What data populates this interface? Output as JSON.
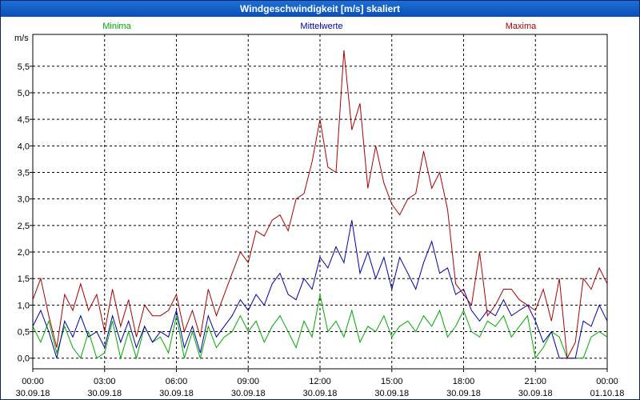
{
  "window": {
    "title": "Windgeschwindigkeit [m/s] skaliert"
  },
  "chart_data": {
    "type": "line",
    "title": "Windgeschwindigkeit [m/s] skaliert",
    "ylabel": "m/s",
    "ylim": [
      -0.2,
      6.1
    ],
    "yticks": [
      0,
      0.5,
      1,
      1.5,
      2,
      2.5,
      3,
      3.5,
      4,
      4.5,
      5,
      5.5
    ],
    "ytick_labels": [
      "0,0",
      "0,5",
      "1,0",
      "1,5",
      "2,0",
      "2,5",
      "3,0",
      "3,5",
      "4,0",
      "4,5",
      "5,0",
      "5,5"
    ],
    "xlim_hours": [
      0,
      24
    ],
    "xticks": [
      {
        "time": "00:00",
        "date": "30.09.18",
        "hour": 0
      },
      {
        "time": "03:00",
        "date": "30.09.18",
        "hour": 3
      },
      {
        "time": "06:00",
        "date": "30.09.18",
        "hour": 6
      },
      {
        "time": "09:00",
        "date": "30.09.18",
        "hour": 9
      },
      {
        "time": "12:00",
        "date": "30.09.18",
        "hour": 12
      },
      {
        "time": "15:00",
        "date": "30.09.18",
        "hour": 15
      },
      {
        "time": "18:00",
        "date": "30.09.18",
        "hour": 18
      },
      {
        "time": "21:00",
        "date": "30.09.18",
        "hour": 21
      },
      {
        "time": "00:00",
        "date": "01.10.18",
        "hour": 24
      }
    ],
    "grid": true,
    "legend_position": "top",
    "series": [
      {
        "name": "Minima",
        "color": "#00aa00",
        "x": [
          0,
          0.33,
          0.67,
          1,
          1.33,
          1.67,
          2,
          2.33,
          2.67,
          3,
          3.33,
          3.67,
          4,
          4.33,
          4.67,
          5,
          5.33,
          5.67,
          6,
          6.33,
          6.67,
          7,
          7.33,
          7.67,
          8,
          8.33,
          8.67,
          9,
          9.33,
          9.67,
          10,
          10.33,
          10.67,
          11,
          11.33,
          11.67,
          12,
          12.33,
          12.67,
          13,
          13.33,
          13.67,
          14,
          14.33,
          14.67,
          15,
          15.33,
          15.67,
          16,
          16.33,
          16.67,
          17,
          17.33,
          17.67,
          18,
          18.33,
          18.67,
          19,
          19.33,
          19.67,
          20,
          20.33,
          20.67,
          21,
          21.33,
          21.67,
          22,
          22.33,
          22.67,
          23,
          23.33,
          23.67,
          24
        ],
        "values": [
          0.6,
          0.3,
          0.7,
          0.1,
          0.6,
          0.2,
          0.0,
          0.5,
          0.0,
          0.1,
          0.7,
          0.0,
          0.5,
          0.0,
          0.6,
          0.3,
          0.4,
          0.1,
          0.8,
          0.0,
          0.5,
          0.0,
          0.6,
          0.2,
          0.4,
          0.5,
          0.8,
          0.5,
          0.7,
          0.3,
          0.6,
          0.8,
          0.5,
          0.2,
          0.7,
          0.4,
          1.2,
          0.5,
          0.7,
          0.4,
          0.9,
          0.3,
          0.6,
          0.5,
          0.8,
          0.4,
          0.6,
          0.7,
          0.5,
          0.8,
          0.6,
          0.9,
          0.4,
          0.6,
          0.9,
          0.5,
          0.4,
          0.7,
          0.6,
          0.8,
          0.4,
          0.6,
          0.8,
          0.0,
          0.2,
          0.5,
          0.4,
          0.0,
          0.0,
          0.0,
          0.4,
          0.5,
          0.4
        ]
      },
      {
        "name": "Mittelwerte",
        "color": "#0000aa",
        "x": [
          0,
          0.33,
          0.67,
          1,
          1.33,
          1.67,
          2,
          2.33,
          2.67,
          3,
          3.33,
          3.67,
          4,
          4.33,
          4.67,
          5,
          5.33,
          5.67,
          6,
          6.33,
          6.67,
          7,
          7.33,
          7.67,
          8,
          8.33,
          8.67,
          9,
          9.33,
          9.67,
          10,
          10.33,
          10.67,
          11,
          11.33,
          11.67,
          12,
          12.33,
          12.67,
          13,
          13.33,
          13.67,
          14,
          14.33,
          14.67,
          15,
          15.33,
          15.67,
          16,
          16.33,
          16.67,
          17,
          17.33,
          17.67,
          18,
          18.33,
          18.67,
          19,
          19.33,
          19.67,
          20,
          20.33,
          20.67,
          21,
          21.33,
          21.67,
          22,
          22.33,
          22.67,
          23,
          23.33,
          23.67,
          24
        ],
        "values": [
          0.6,
          0.9,
          0.5,
          0.0,
          0.7,
          0.4,
          0.8,
          0.4,
          0.5,
          0.2,
          0.8,
          0.3,
          0.7,
          0.2,
          0.6,
          0.3,
          0.5,
          0.4,
          0.9,
          0.2,
          0.6,
          0.1,
          0.8,
          0.4,
          0.6,
          0.8,
          1.1,
          0.9,
          1.2,
          1.0,
          1.4,
          1.6,
          1.2,
          1.1,
          1.5,
          1.3,
          1.9,
          1.7,
          2.1,
          1.8,
          2.6,
          1.6,
          2.0,
          1.5,
          1.9,
          1.3,
          1.9,
          1.6,
          1.3,
          1.8,
          2.2,
          1.6,
          1.7,
          1.2,
          1.3,
          0.9,
          0.7,
          0.9,
          0.8,
          1.1,
          0.8,
          0.9,
          1.0,
          0.7,
          0.3,
          0.5,
          0.0,
          0.0,
          0.0,
          0.7,
          0.6,
          1.0,
          0.7
        ]
      },
      {
        "name": "Maxima",
        "color": "#aa0000",
        "x": [
          0,
          0.33,
          0.67,
          1,
          1.33,
          1.67,
          2,
          2.33,
          2.67,
          3,
          3.33,
          3.67,
          4,
          4.33,
          4.67,
          5,
          5.33,
          5.67,
          6,
          6.33,
          6.67,
          7,
          7.33,
          7.67,
          8,
          8.33,
          8.67,
          9,
          9.33,
          9.67,
          10,
          10.33,
          10.67,
          11,
          11.33,
          11.67,
          12,
          12.33,
          12.67,
          13,
          13.33,
          13.67,
          14,
          14.33,
          14.67,
          15,
          15.33,
          15.67,
          16,
          16.33,
          16.67,
          17,
          17.33,
          17.67,
          18,
          18.33,
          18.67,
          19,
          19.33,
          19.67,
          20,
          20.33,
          20.67,
          21,
          21.33,
          21.67,
          22,
          22.33,
          22.67,
          23,
          23.33,
          23.67,
          24
        ],
        "values": [
          1.1,
          1.5,
          0.8,
          0.2,
          1.2,
          0.9,
          1.4,
          0.9,
          1.2,
          0.5,
          1.3,
          0.6,
          1.1,
          0.4,
          1.0,
          0.8,
          0.8,
          0.9,
          1.2,
          0.5,
          0.9,
          0.4,
          1.3,
          0.8,
          1.2,
          1.6,
          2.0,
          1.8,
          2.4,
          2.3,
          2.6,
          2.7,
          2.4,
          3.0,
          3.1,
          3.7,
          4.5,
          3.6,
          3.5,
          5.8,
          4.3,
          4.8,
          3.2,
          4.0,
          3.3,
          2.9,
          2.7,
          3.0,
          3.1,
          3.9,
          3.2,
          3.5,
          2.8,
          1.4,
          1.2,
          1.0,
          2.0,
          0.8,
          1.0,
          1.3,
          1.3,
          1.1,
          1.0,
          0.9,
          1.3,
          0.7,
          1.5,
          0.0,
          0.3,
          1.5,
          1.3,
          1.7,
          1.4
        ]
      }
    ]
  }
}
